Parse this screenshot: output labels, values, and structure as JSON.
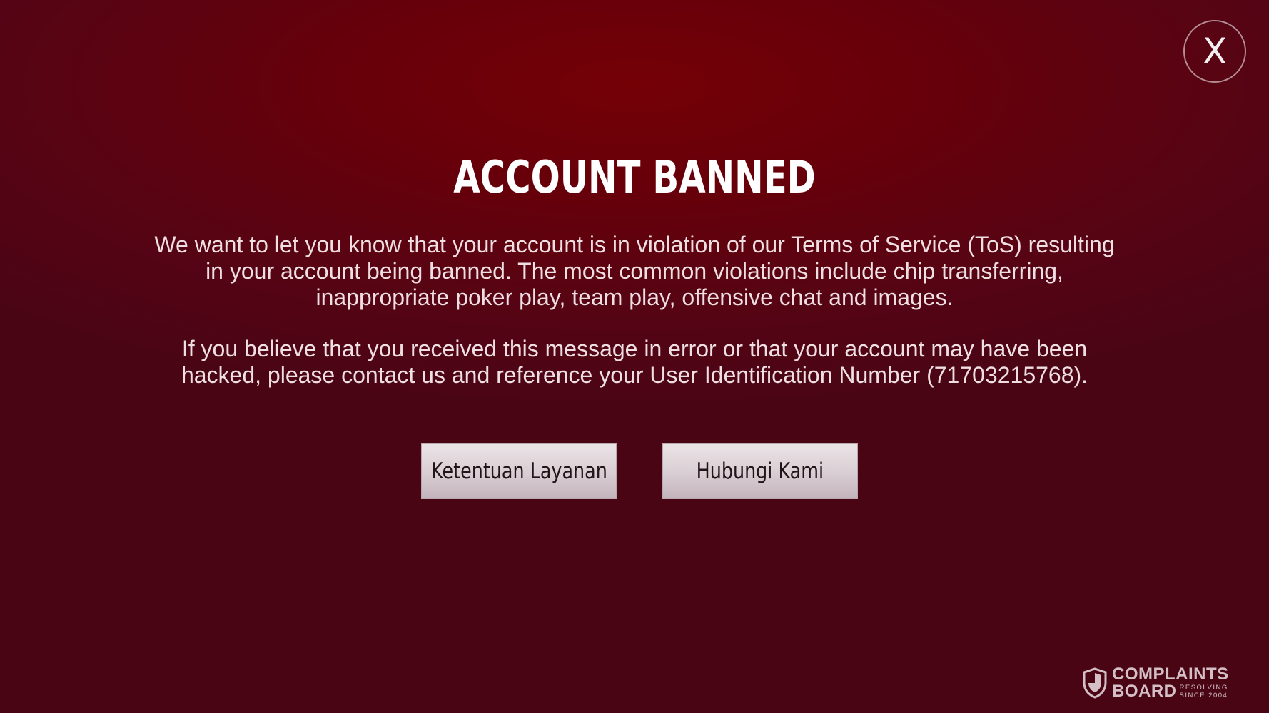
{
  "dialog": {
    "close_label": "X",
    "title": "ACCOUNT BANNED",
    "message_paragraph_1": "We want to let you know that your account is in violation of our Terms of Service (ToS) resulting in your account being banned. The most common violations include chip transferring, inappropriate poker play, team play, offensive chat and images.",
    "message_paragraph_2": "If you believe that you received this message in error or that your account may have been hacked, please contact us and reference your User Identification Number (71703215768).",
    "buttons": [
      {
        "label": "Ketentuan Layanan"
      },
      {
        "label": "Hubungi Kami"
      }
    ]
  },
  "watermark": {
    "line1": "COMPLAINTS",
    "line2": "BOARD",
    "tag1": "RESOLVING",
    "tag2": "SINCE 2004",
    "icon": "shield-icon"
  },
  "colors": {
    "background": "#66000a",
    "background_edge": "#4a0515",
    "text": "#efdfe2",
    "button": "#dcd1d6"
  }
}
